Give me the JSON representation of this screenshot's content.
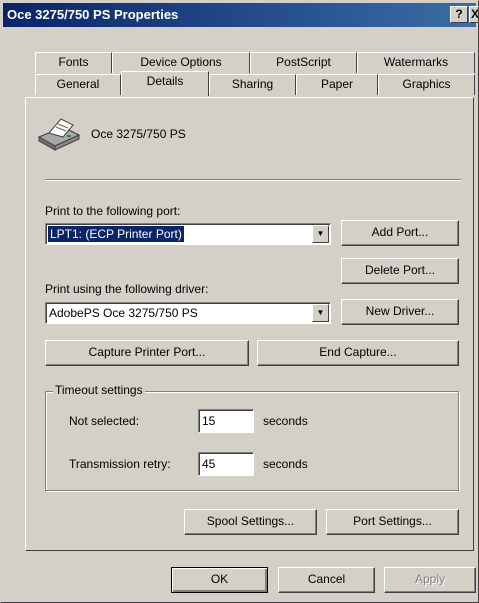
{
  "window": {
    "title": "Oce 3275/750 PS Properties",
    "help_glyph": "?",
    "close_glyph": "X"
  },
  "tabs": {
    "row1": [
      "Fonts",
      "Device Options",
      "PostScript",
      "Watermarks"
    ],
    "row2": [
      "General",
      "Details",
      "Sharing",
      "Paper",
      "Graphics"
    ],
    "active": "Details"
  },
  "printer": {
    "name": "Oce 3275/750 PS",
    "icon": "printer-icon"
  },
  "port": {
    "label": "Print to the following port:",
    "value": "LPT1:  (ECP Printer Port)",
    "add_button": "Add Port...",
    "delete_button": "Delete Port..."
  },
  "driver": {
    "label": "Print using the following driver:",
    "value": "AdobePS Oce 3275/750 PS",
    "new_button": "New Driver..."
  },
  "capture": {
    "capture_button": "Capture Printer Port...",
    "end_button": "End Capture..."
  },
  "timeout": {
    "group_label": "Timeout settings",
    "not_selected_label": "Not selected:",
    "not_selected_value": "15",
    "retry_label": "Transmission retry:",
    "retry_value": "45",
    "units": "seconds"
  },
  "settings": {
    "spool_button": "Spool Settings...",
    "port_button": "Port Settings..."
  },
  "footer": {
    "ok": "OK",
    "cancel": "Cancel",
    "apply": "Apply"
  },
  "colors": {
    "face": "#d4d0c8",
    "title_start": "#0a246a",
    "title_end": "#3a6ea5",
    "selection": "#0a246a"
  }
}
